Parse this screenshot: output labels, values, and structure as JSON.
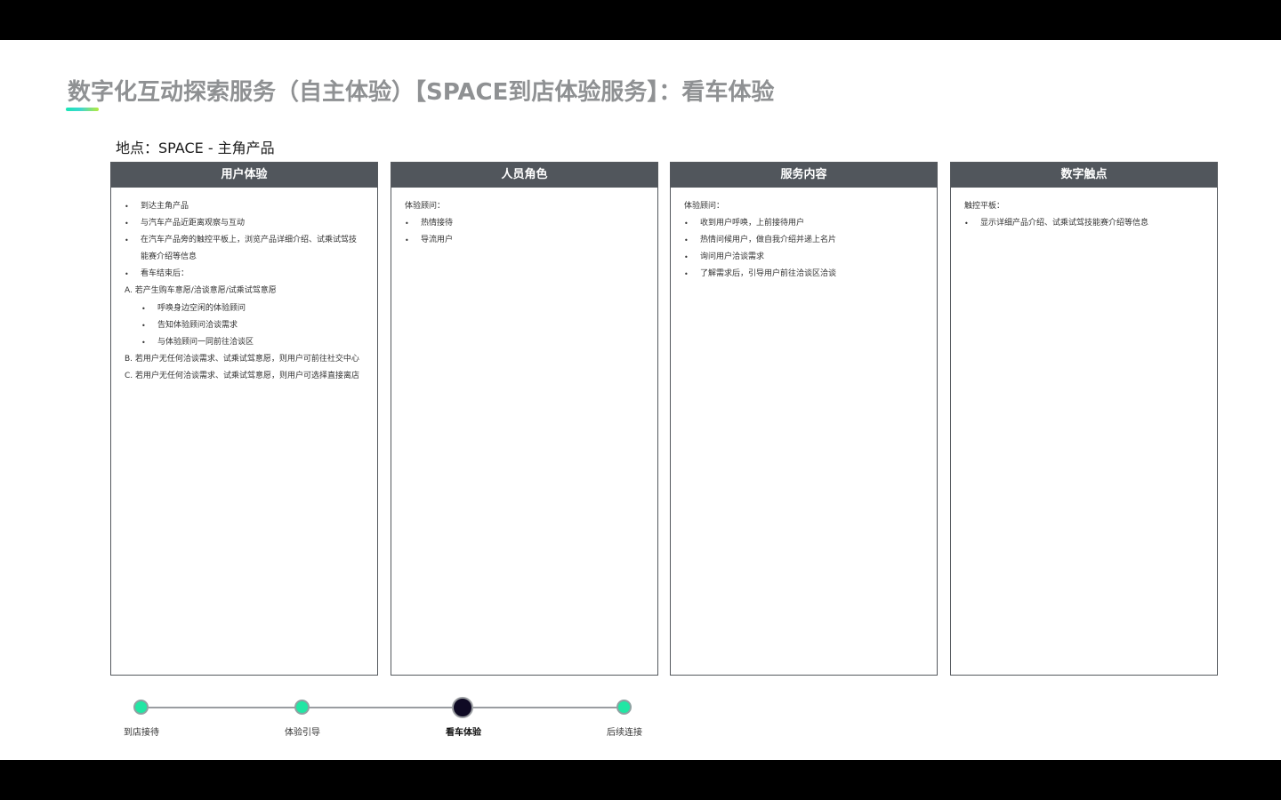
{
  "title": "数字化互动探索服务（自主体验）【SPACE到店体验服务】：看车体验",
  "location": "地点：SPACE - 主角产品",
  "columns": [
    {
      "header": "用户体验",
      "lines": [
        {
          "type": "bullet",
          "text": "到达主角产品"
        },
        {
          "type": "bullet",
          "text": "与汽车产品近距离观察与互动"
        },
        {
          "type": "bullet",
          "text": "在汽车产品旁的触控平板上，浏览产品详细介绍、试乘试驾技"
        },
        {
          "type": "cont",
          "text": "能赛介绍等信息"
        },
        {
          "type": "bullet",
          "text": "看车结束后："
        },
        {
          "type": "lettered",
          "text": "A. 若产生购车意愿/洽谈意愿/试乘试驾意愿"
        },
        {
          "type": "sub",
          "text": "呼唤身边空闲的体验顾问"
        },
        {
          "type": "sub",
          "text": "告知体验顾问洽谈需求"
        },
        {
          "type": "sub",
          "text": "与体验顾问一同前往洽谈区"
        },
        {
          "type": "lettered",
          "text": "B. 若用户无任何洽谈需求、试乘试驾意愿，则用户可前往社交中心"
        },
        {
          "type": "lettered",
          "text": "C. 若用户无任何洽谈需求、试乘试驾意愿，则用户可选择直接离店"
        }
      ]
    },
    {
      "header": "人员角色",
      "lines": [
        {
          "type": "plain",
          "text": "体验顾问："
        },
        {
          "type": "bullet",
          "text": "热情接待"
        },
        {
          "type": "bullet",
          "text": "导流用户"
        }
      ]
    },
    {
      "header": "服务内容",
      "lines": [
        {
          "type": "plain",
          "text": "体验顾问："
        },
        {
          "type": "bullet",
          "text": "收到用户呼唤，上前接待用户"
        },
        {
          "type": "bullet",
          "text": "热情问候用户，做自我介绍并递上名片"
        },
        {
          "type": "bullet",
          "text": "询问用户洽谈需求"
        },
        {
          "type": "bullet",
          "text": "了解需求后，引导用户前往洽谈区洽谈"
        }
      ]
    },
    {
      "header": "数字触点",
      "lines": [
        {
          "type": "plain",
          "text": "触控平板："
        },
        {
          "type": "bullet",
          "text": "显示详细产品介绍、试乘试驾技能赛介绍等信息"
        }
      ]
    }
  ],
  "timeline": {
    "active_index": 2,
    "steps": [
      {
        "label": "到店接待"
      },
      {
        "label": "体验引导"
      },
      {
        "label": "看车体验"
      },
      {
        "label": "后续连接"
      }
    ]
  },
  "colors": {
    "header_bg": "#51565c",
    "node_done": "#22e6a4",
    "node_active": "#0f0a24",
    "title_gray": "#8f9193"
  }
}
